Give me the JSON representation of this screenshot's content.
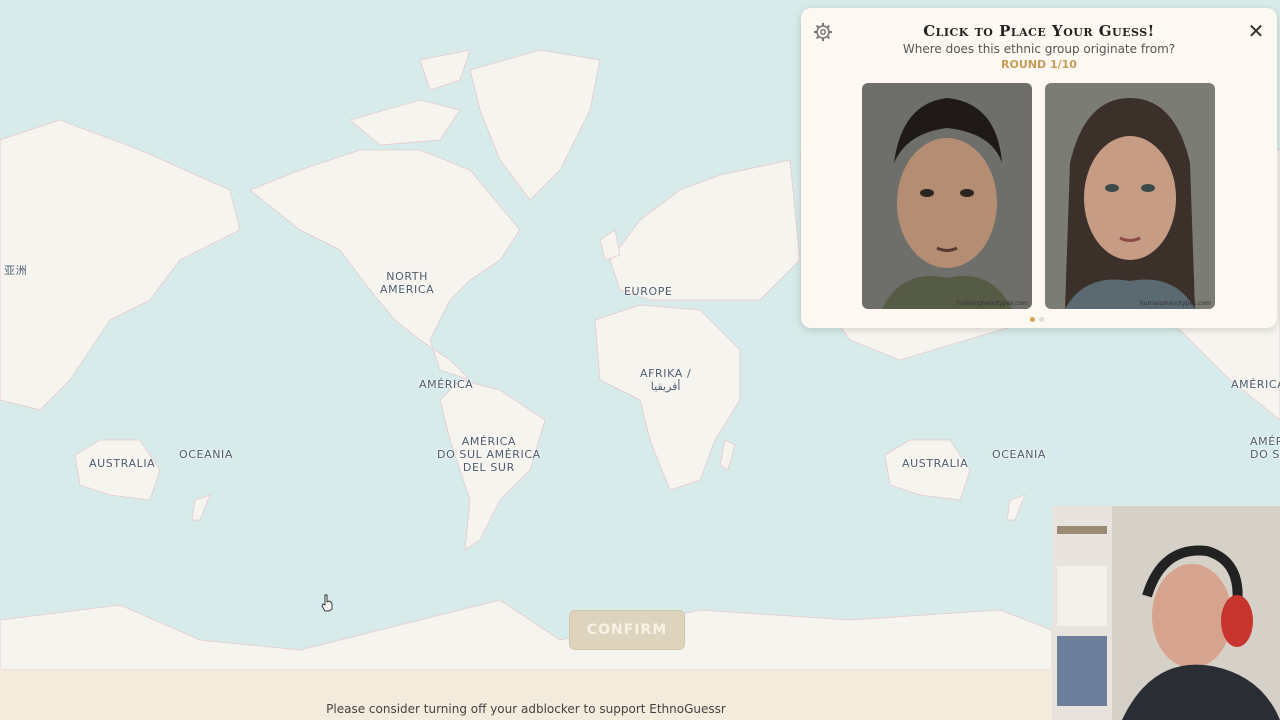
{
  "map": {
    "labels": {
      "asia_left": "亚洲",
      "north_america": "NORTH\nAMERICA",
      "europe": "EUROPE",
      "america": "AMÉRICA",
      "africa": "AFRIKA /\nأفريقيا",
      "south_america": "AMÉRICA\nDO SUL AMÉRICA\nDEL SUR",
      "australia": "AUSTRALIA",
      "oceania": "OCEANIA",
      "australia_right": "AUSTRALIA",
      "oceania_right": "OCEANIA",
      "america_right": "AMÉRICA",
      "south_america_right": "AMÉRICA\nDO SUL"
    }
  },
  "confirm_label": "CONFIRM",
  "footer_text": "Please consider turning off your adblocker to support EthnoGuessr",
  "panel": {
    "title": "Click to Place Your Guess!",
    "subtitle": "Where does this ethnic group originate from?",
    "round": "ROUND 1/10",
    "close_glyph": "✕",
    "images": [
      {
        "credit": "humanphenotypes.com"
      },
      {
        "credit": "humanphenotypes.com"
      }
    ]
  },
  "colors": {
    "ocean": "#d7ebea",
    "land": "#f6f4ee",
    "accent": "#d4a24c",
    "confirm_bg": "#ded4bd"
  },
  "icons": {
    "settings": "gear-icon",
    "close": "close-icon",
    "cursor": "hand-cursor-icon"
  }
}
